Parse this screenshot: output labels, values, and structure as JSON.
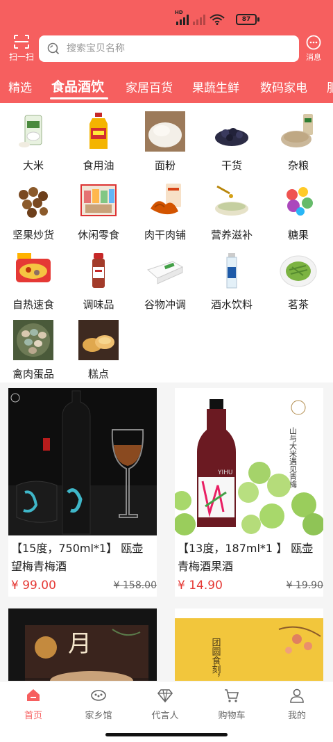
{
  "status": {
    "battery": "87",
    "hd": "HD"
  },
  "header": {
    "scan_label": "扫一扫",
    "search_placeholder": "搜索宝贝名称",
    "message_label": "消息"
  },
  "tabs": [
    {
      "label": "精选"
    },
    {
      "label": "食品酒饮",
      "active": true
    },
    {
      "label": "家居百货"
    },
    {
      "label": "果蔬生鲜"
    },
    {
      "label": "数码家电"
    },
    {
      "label": "服"
    }
  ],
  "categories": [
    {
      "label": "大米",
      "icon": "rice-bag-icon"
    },
    {
      "label": "食用油",
      "icon": "oil-bottle-icon"
    },
    {
      "label": "面粉",
      "icon": "flour-icon"
    },
    {
      "label": "干货",
      "icon": "dried-food-icon"
    },
    {
      "label": "杂粮",
      "icon": "grains-icon"
    },
    {
      "label": "坚果炒货",
      "icon": "nuts-icon"
    },
    {
      "label": "休闲零食",
      "icon": "snacks-icon"
    },
    {
      "label": "肉干肉铺",
      "icon": "jerky-icon"
    },
    {
      "label": "营养滋补",
      "icon": "nutrition-icon"
    },
    {
      "label": "糖果",
      "icon": "candy-icon"
    },
    {
      "label": "自热速食",
      "icon": "self-heating-food-icon"
    },
    {
      "label": "调味品",
      "icon": "seasoning-icon"
    },
    {
      "label": "谷物冲调",
      "icon": "cereal-drink-icon"
    },
    {
      "label": "酒水饮料",
      "icon": "beverage-icon"
    },
    {
      "label": "茗茶",
      "icon": "tea-icon"
    },
    {
      "label": "禽肉蛋品",
      "icon": "eggs-icon"
    },
    {
      "label": "糕点",
      "icon": "pastry-icon"
    }
  ],
  "products": [
    {
      "title": "【15度，750ml*1】 瓯壶 望梅青梅酒",
      "price": "¥ 99.00",
      "old_price": "¥ 158.00"
    },
    {
      "title": "【13度，187ml*1 】 瓯壶青梅酒果酒",
      "price": "¥ 14.90",
      "old_price": "¥ 19.90"
    },
    {
      "title": "",
      "price": "",
      "old_price": ""
    },
    {
      "title": "",
      "price": "",
      "old_price": ""
    }
  ],
  "product_image_text": {
    "p2_vertical": "山与大米遇见青梅",
    "p4_poem": "团圆食刻，有它相伴。",
    "p2_brand": "YIHU"
  },
  "tabbar": [
    {
      "label": "首页",
      "icon": "home-icon",
      "active": true
    },
    {
      "label": "家乡馆",
      "icon": "hometown-icon"
    },
    {
      "label": "代言人",
      "icon": "diamond-icon"
    },
    {
      "label": "购物车",
      "icon": "cart-icon"
    },
    {
      "label": "我的",
      "icon": "profile-icon"
    }
  ],
  "colors": {
    "brand": "#f65f5f",
    "price": "#e53935"
  }
}
